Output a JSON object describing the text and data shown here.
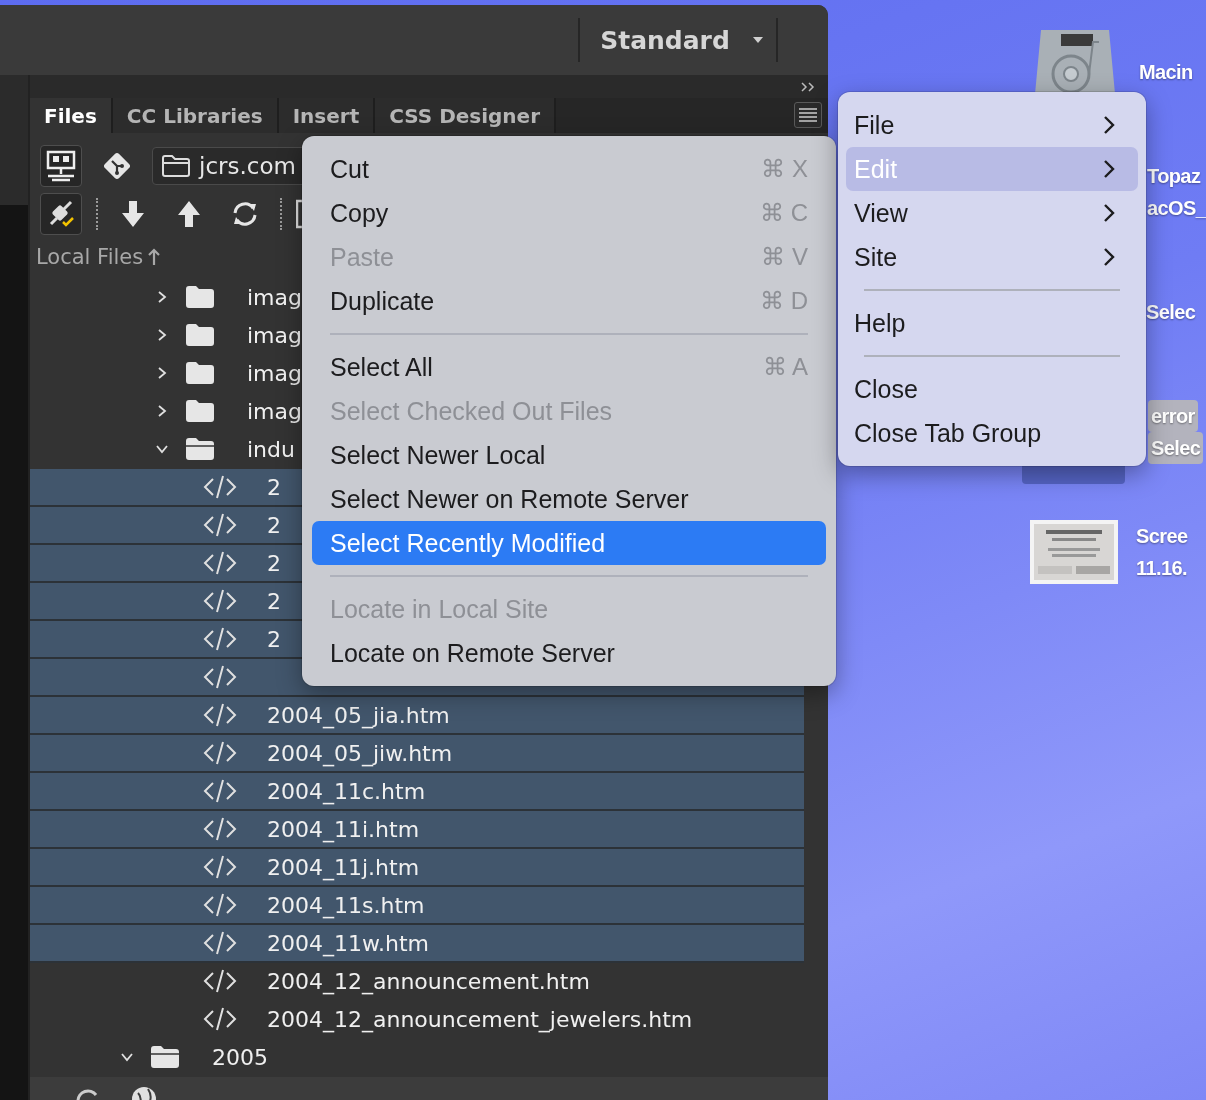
{
  "workspace": {
    "label": "Standard"
  },
  "tabs": [
    {
      "label": "Files",
      "selected": true
    },
    {
      "label": "CC Libraries",
      "selected": false
    },
    {
      "label": "Insert",
      "selected": false
    },
    {
      "label": "CSS Designer",
      "selected": false
    }
  ],
  "site_select": {
    "value": "jcrs.com"
  },
  "local_files_header": "Local Files",
  "tree": [
    {
      "children": [
        {
          "kind": "folder",
          "name": "imag",
          "expanded": false
        },
        {
          "kind": "folder",
          "name": "imag",
          "expanded": false
        },
        {
          "kind": "folder",
          "name": "imag",
          "expanded": false
        },
        {
          "kind": "folder",
          "name": "imag",
          "expanded": false
        },
        {
          "kind": "folder",
          "name": "indu",
          "expanded": true,
          "children": [
            {
              "kind": "file",
              "name": "2",
              "selected": true
            },
            {
              "kind": "file",
              "name": "2",
              "selected": true
            },
            {
              "kind": "file",
              "name": "2",
              "selected": true
            },
            {
              "kind": "file",
              "name": "2",
              "selected": true
            },
            {
              "kind": "file",
              "name": "2",
              "selected": true
            },
            {
              "kind": "file",
              "selected": true
            },
            {
              "kind": "file",
              "name": "2004_05_jia.htm",
              "selected": true
            },
            {
              "kind": "file",
              "name": "2004_05_jiw.htm",
              "selected": true
            },
            {
              "kind": "file",
              "name": "2004_11c.htm",
              "selected": true
            },
            {
              "kind": "file",
              "name": "2004_11i.htm",
              "selected": true
            },
            {
              "kind": "file",
              "name": "2004_11j.htm",
              "selected": true
            },
            {
              "kind": "file",
              "name": "2004_11s.htm",
              "selected": true
            },
            {
              "kind": "file",
              "name": "2004_11w.htm",
              "selected": true
            },
            {
              "kind": "file",
              "name": "2004_12_announcement.htm",
              "selected": false
            },
            {
              "kind": "file",
              "name": "2004_12_announcement_jewelers.htm",
              "selected": false
            }
          ]
        }
      ]
    },
    {
      "kind": "folder",
      "name": "2005",
      "expanded": true
    }
  ],
  "edit_menu": [
    {
      "kind": "item",
      "label": "Cut",
      "shortcut": "⌘ X",
      "disabled": false,
      "selected": false
    },
    {
      "kind": "item",
      "label": "Copy",
      "shortcut": "⌘ C",
      "disabled": false,
      "selected": false
    },
    {
      "kind": "item",
      "label": "Paste",
      "shortcut": "⌘ V",
      "disabled": true,
      "selected": false
    },
    {
      "kind": "item",
      "label": "Duplicate",
      "shortcut": "⌘ D",
      "disabled": false,
      "selected": false
    },
    {
      "kind": "separator"
    },
    {
      "kind": "item",
      "label": "Select All",
      "shortcut": "⌘ A",
      "disabled": false,
      "selected": false
    },
    {
      "kind": "item",
      "label": "Select Checked Out Files",
      "disabled": true,
      "selected": false
    },
    {
      "kind": "item",
      "label": "Select Newer Local",
      "disabled": false,
      "selected": false
    },
    {
      "kind": "item",
      "label": "Select Newer on Remote Server",
      "disabled": false,
      "selected": false
    },
    {
      "kind": "item",
      "label": "Select Recently Modified",
      "disabled": false,
      "selected": true
    },
    {
      "kind": "separator"
    },
    {
      "kind": "item",
      "label": "Locate in Local Site",
      "disabled": true,
      "selected": false
    },
    {
      "kind": "item",
      "label": "Locate on Remote Server",
      "disabled": false,
      "selected": false
    }
  ],
  "panel_menu": [
    {
      "kind": "item",
      "label": "File",
      "submenu": true,
      "selected": false
    },
    {
      "kind": "item",
      "label": "Edit",
      "submenu": true,
      "selected": true
    },
    {
      "kind": "item",
      "label": "View",
      "submenu": true,
      "selected": false
    },
    {
      "kind": "item",
      "label": "Site",
      "submenu": true,
      "selected": false
    },
    {
      "kind": "separator"
    },
    {
      "kind": "item",
      "label": "Help",
      "submenu": false,
      "selected": false
    },
    {
      "kind": "separator"
    },
    {
      "kind": "item",
      "label": "Close",
      "submenu": false,
      "selected": false
    },
    {
      "kind": "item",
      "label": "Close Tab Group",
      "submenu": false,
      "selected": false
    }
  ],
  "desktop_icons": [
    {
      "kind": "disk",
      "lines": [
        "Macin"
      ]
    },
    {
      "kind": "hidden",
      "lines": [
        "Topaz",
        "acOS_"
      ]
    },
    {
      "kind": "hidden",
      "lines": [
        "Selec"
      ]
    },
    {
      "kind": "selected",
      "lines": [
        "error",
        "Selec"
      ]
    },
    {
      "kind": "screenshot",
      "lines": [
        "Scree",
        "11.16."
      ]
    }
  ]
}
